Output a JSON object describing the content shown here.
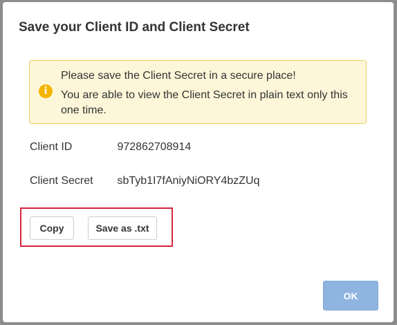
{
  "dialog": {
    "title": "Save your Client ID and Client Secret"
  },
  "alert": {
    "icon": "info-icon",
    "icon_glyph": "i",
    "line1": "Please save the Client Secret in a secure place!",
    "line2": "You are able to view the Client Secret in plain text only this one time.",
    "background": "#fdf6d8",
    "border": "#f0cf63",
    "icon_color": "#f5b400"
  },
  "fields": {
    "client_id": {
      "label": "Client ID",
      "value": "972862708914"
    },
    "client_secret": {
      "label": "Client Secret",
      "value": "sbTyb1I7fAniyNiORY4bzZUq"
    }
  },
  "actions": {
    "copy_label": "Copy",
    "save_label": "Save as .txt",
    "highlight_color": "#d6243a"
  },
  "footer": {
    "ok_label": "OK",
    "ok_color": "#8fb4e0"
  }
}
